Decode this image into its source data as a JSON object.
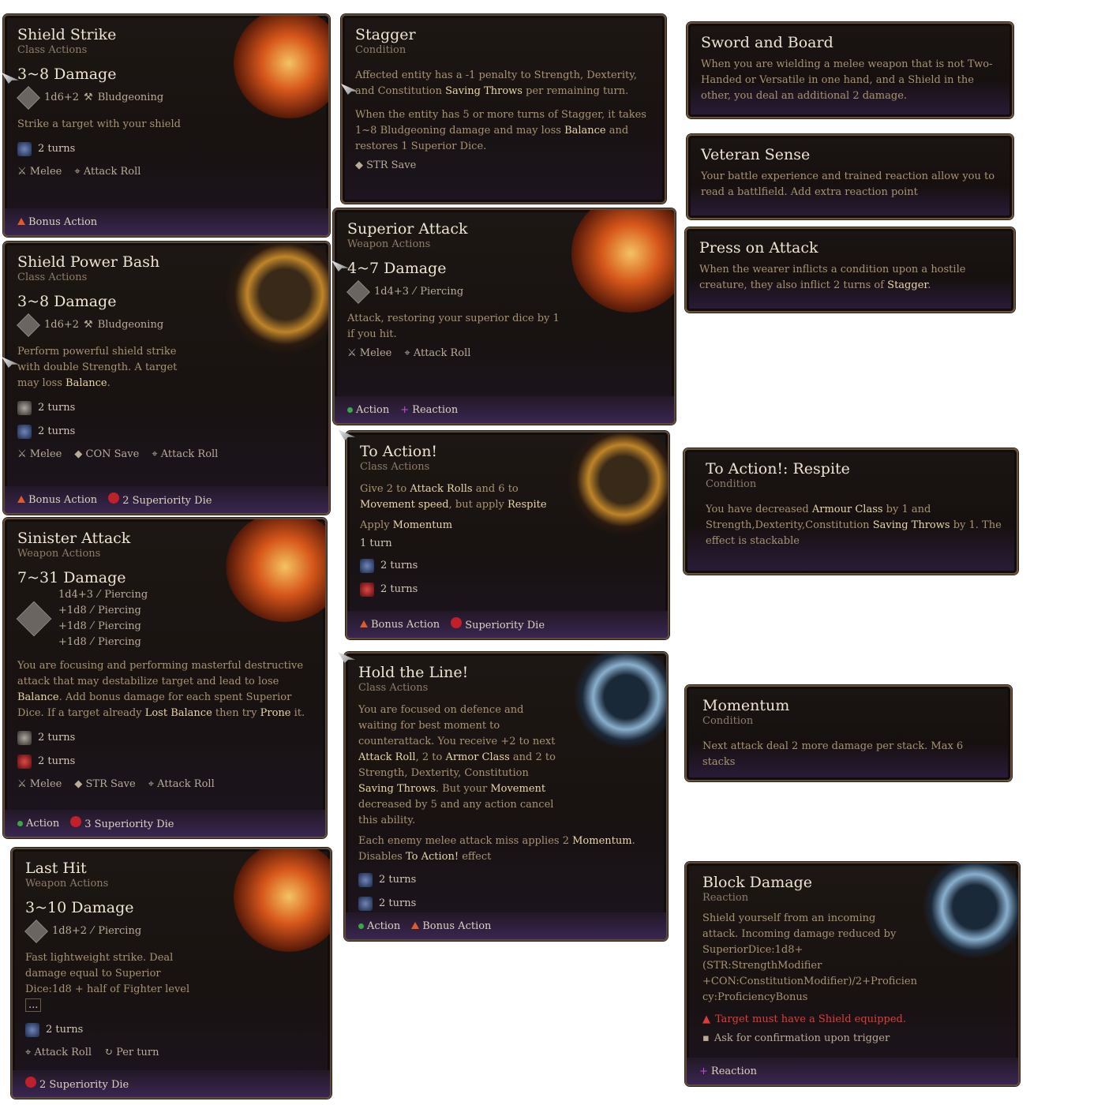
{
  "shield_strike": {
    "title": "Shield Strike",
    "sub": "Class Actions",
    "damage": "3~8 Damage",
    "roll": "1d6+2",
    "dtype": "Bludgeoning",
    "desc": "Strike a target with your shield",
    "turns": "2 turns",
    "tag1": "Melee",
    "tag2": "Attack Roll",
    "footer": "Bonus Action"
  },
  "shield_power_bash": {
    "title": "Shield Power Bash",
    "sub": "Class Actions",
    "damage": "3~8 Damage",
    "roll": "1d6+2",
    "dtype": "Bludgeoning",
    "desc_a": "Perform powerful shield strike with double Strength. A target may loss ",
    "desc_hl": "Balance",
    "desc_b": ".",
    "turns1": "2 turns",
    "turns2": "2 turns",
    "tag1": "Melee",
    "tag2": "CON Save",
    "tag3": "Attack Roll",
    "footer1": "Bonus Action",
    "footer2": "2 Superiority Die"
  },
  "sinister_attack": {
    "title": "Sinister Attack",
    "sub": "Weapon Actions",
    "damage": "7~31 Damage",
    "rolls": [
      "1d4+3",
      "+1d8",
      "+1d8",
      "+1d8"
    ],
    "dtype": "Piercing",
    "desc_a": "You are focusing and performing masterful destructive attack that may destabilize target and lead to lose ",
    "hl1": "Balance",
    "desc_b": ". Add bonus damage for each spent Superior Dice. If a target already ",
    "hl2": "Lost Balance",
    "desc_c": " then try ",
    "hl3": "Prone",
    "desc_d": " it.",
    "turns1": "2 turns",
    "turns2": "2 turns",
    "tag1": "Melee",
    "tag2": "STR Save",
    "tag3": "Attack Roll",
    "footer1": "Action",
    "footer2": "3 Superiority Die"
  },
  "last_hit": {
    "title": "Last Hit",
    "sub": "Weapon Actions",
    "damage": "3~10 Damage",
    "roll": "1d8+2",
    "dtype": "Piercing",
    "desc": "Fast lightweight strike. Deal damage equal to Superior Dice:1d8 + half of Fighter level",
    "more": "...",
    "turns": "2 turns",
    "tag1": "Attack Roll",
    "tag2": "Per turn",
    "footer": "2 Superiority Die"
  },
  "stagger": {
    "title": "Stagger",
    "sub": "Condition",
    "desc_a": "Affected entity has a -1 penalty to Strength, Dexterity, and Constitution ",
    "hl1": "Saving Throws",
    "desc_b": " per remaining turn.",
    "desc2_a": "When the entity has 5 or more turns of Stagger, it takes 1~8 Bludgeoning damage and may loss ",
    "hl2": "Balance",
    "desc2_b": " and restores 1 Superior Dice.",
    "save": "STR Save"
  },
  "superior_attack": {
    "title": "Superior Attack",
    "sub": "Weapon Actions",
    "damage": "4~7 Damage",
    "roll": "1d4+3",
    "dtype": "Piercing",
    "desc": "Attack, restoring your superior dice by 1 if you hit.",
    "tag1": "Melee",
    "tag2": "Attack Roll",
    "footer1": "Action",
    "footer2": "Reaction"
  },
  "to_action": {
    "title": "To Action!",
    "sub": "Class Actions",
    "d1": "Give 2 to ",
    "h1": "Attack Rolls",
    "d2": " and 6 to ",
    "h2": "Movement speed",
    "d3": ", but apply ",
    "h3": "Respite",
    "apply": "Apply ",
    "h4": "Momentum",
    "turn1": "1 turn",
    "turns2": "2 turns",
    "turns3": "2 turns",
    "footer1": "Bonus Action",
    "footer2": "Superiority Die"
  },
  "hold_the_line": {
    "title": "Hold the Line!",
    "sub": "Class Actions",
    "d1": "You are focused on defence and waiting for best moment to counterattack. You receive +2 to next ",
    "h1": "Attack Roll",
    "d2": ", 2 to ",
    "h2": "Armor Class",
    "d3": " and 2 to Strength, Dexterity, Constitution ",
    "h3": "Saving Throws",
    "d4": ". But your ",
    "h4": "Movement",
    "d5": " decreased by 5 and any action cancel this ability.",
    "e1": "Each enemy melee attack miss applies 2 ",
    "h5": "Momentum",
    "e2": ". Disables ",
    "h6": "To Action!",
    "e3": " effect",
    "turns1": "2 turns",
    "turns2": "2 turns",
    "footer1": "Action",
    "footer2": "Bonus Action"
  },
  "sword_and_board": {
    "title": "Sword and Board",
    "desc": "When you are wielding a melee weapon that is not Two-Handed or Versatile in one hand, and a Shield in the other, you deal an additional 2 damage."
  },
  "veteran_sense": {
    "title": "Veteran Sense",
    "desc": "Your battle experience and trained reaction allow you to read a battlfield. Add extra reaction point"
  },
  "press_on_attack": {
    "title": "Press on Attack",
    "d1": "When the wearer inflicts a condition upon a hostile creature, they also inflict 2 turns of ",
    "h1": "Stagger",
    "d2": "."
  },
  "respite": {
    "title": "To Action!: Respite",
    "sub": "Condition",
    "d1": "You have decreased ",
    "h1": "Armour Class",
    "d2": " by 1 and Strength,Dexterity,Constitution ",
    "h2": "Saving Throws",
    "d3": " by  1. The effect is stackable"
  },
  "momentum": {
    "title": "Momentum",
    "sub": "Condition",
    "desc": "Next attack deal 2 more damage per stack. Max 6 stacks"
  },
  "block_damage": {
    "title": "Block Damage",
    "sub": "Reaction",
    "desc": "Shield yourself from an incoming attack. Incoming damage reduced by SuperiorDice:1d8+(STR:StrengthModifier +CON:ConstitutionModifier)/2+Proficien cy:ProficiencyBonus",
    "warn": "Target must have a Shield equipped.",
    "ask": "Ask for confirmation upon trigger",
    "footer": "Reaction"
  },
  "colors": {
    "highlight": "#e8d7a8",
    "bonus": "#e05a2a",
    "action": "#3aa84a",
    "reaction": "#c24fd6"
  }
}
